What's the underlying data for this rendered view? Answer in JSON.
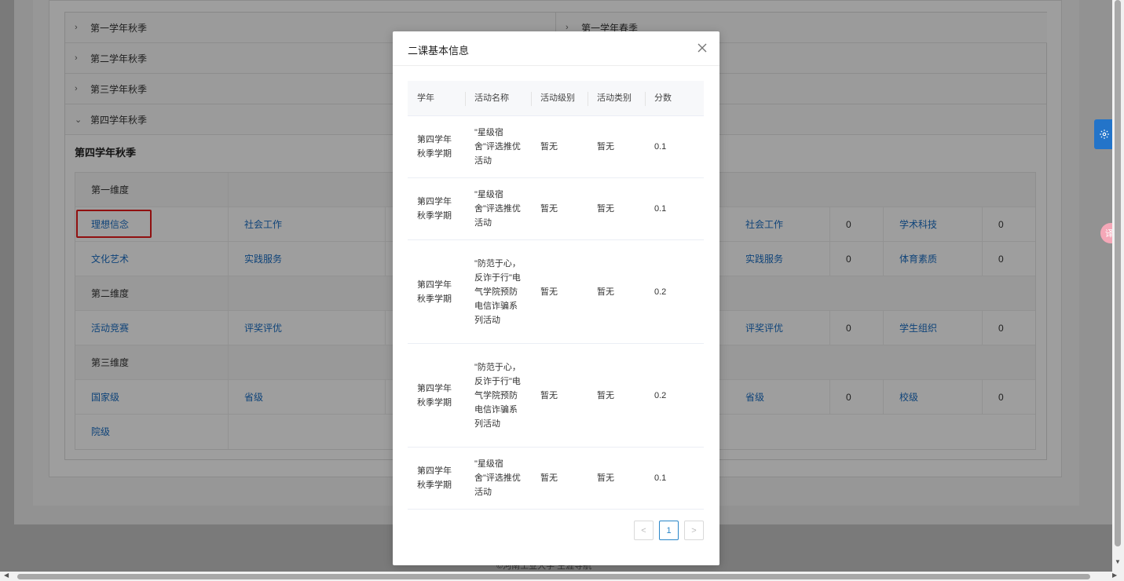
{
  "collapse": {
    "left_items": [
      "第一学年秋季",
      "第二学年秋季",
      "第三学年秋季",
      "第四学年秋季"
    ],
    "right_items": [
      "第一学年春季"
    ]
  },
  "section": {
    "title": "第四学年秋季",
    "rows": [
      {
        "type": "header",
        "label": "第一维度"
      },
      {
        "type": "data",
        "cells": [
          "理想信念",
          "社会工作"
        ],
        "right": [
          "社会工作",
          "0",
          "学术科技",
          "0"
        ]
      },
      {
        "type": "data",
        "cells": [
          "文化艺术",
          "实践服务"
        ],
        "right": [
          "实践服务",
          "0",
          "体育素质",
          "0"
        ]
      },
      {
        "type": "header",
        "label": "第二维度"
      },
      {
        "type": "data",
        "cells": [
          "活动竞赛",
          "评奖评优"
        ],
        "right": [
          "评奖评优",
          "0",
          "学生组织",
          "0"
        ]
      },
      {
        "type": "header",
        "label": "第三维度"
      },
      {
        "type": "data",
        "cells": [
          "国家级",
          "省级"
        ],
        "right": [
          "省级",
          "0",
          "校级",
          "0"
        ]
      },
      {
        "type": "data",
        "cells": [
          "院级",
          ""
        ],
        "right": []
      }
    ]
  },
  "footer": "©河南工业大学 生涯导航",
  "side": {
    "settings_icon": "gear-icon",
    "translate_label": "译A"
  },
  "modal": {
    "title": "二课基本信息",
    "columns": [
      "学年",
      "活动名称",
      "活动级别",
      "活动类别",
      "分数"
    ],
    "rows": [
      {
        "year": "第四学年秋季学期",
        "name": "\"星级宿舍\"评选推优活动",
        "level": "暂无",
        "category": "暂无",
        "score": "0.1"
      },
      {
        "year": "第四学年秋季学期",
        "name": "\"星级宿舍\"评选推优活动",
        "level": "暂无",
        "category": "暂无",
        "score": "0.1"
      },
      {
        "year": "第四学年秋季学期",
        "name": "\"防范于心，反诈于行\"电气学院预防电信诈骗系列活动",
        "level": "暂无",
        "category": "暂无",
        "score": "0.2"
      },
      {
        "year": "第四学年秋季学期",
        "name": "\"防范于心，反诈于行\"电气学院预防电信诈骗系列活动",
        "level": "暂无",
        "category": "暂无",
        "score": "0.2"
      },
      {
        "year": "第四学年秋季学期",
        "name": "\"星级宿舍\"评选推优活动",
        "level": "暂无",
        "category": "暂无",
        "score": "0.1"
      }
    ],
    "pagination": {
      "prev": "<",
      "current": "1",
      "next": ">"
    }
  }
}
